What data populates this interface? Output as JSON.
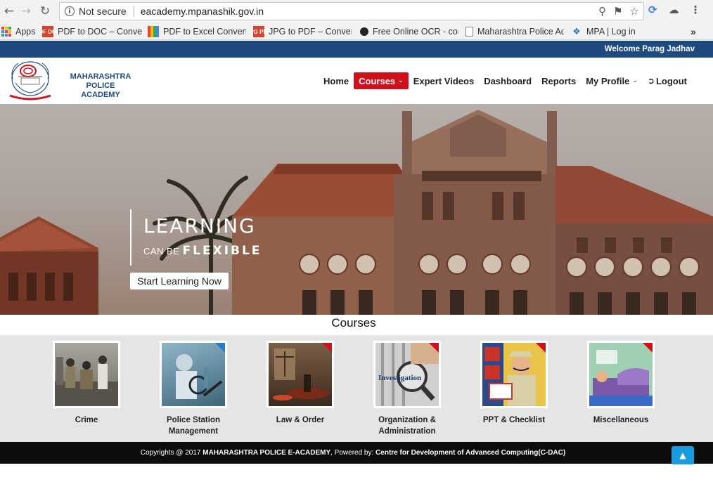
{
  "browser": {
    "security_label": "Not secure",
    "url": "eacademy.mpanashik.gov.in",
    "bookmarks": [
      {
        "label": "Apps"
      },
      {
        "label": "PDF to DOC – Convert"
      },
      {
        "label": "PDF to Excel Converte"
      },
      {
        "label": "JPG to PDF – Convert"
      },
      {
        "label": "Free Online OCR - cor"
      },
      {
        "label": "Maharashtra Police Ac"
      },
      {
        "label": "MPA | Log in"
      }
    ],
    "bookmark_badges": {
      "pdf_doc": "PDF DOC",
      "jpg_pdf": "JPG PDF"
    },
    "more_bookmarks": "»"
  },
  "site": {
    "welcome": "Welcome Parag Jadhav",
    "brand_line1": "MAHARASHTRA POLICE",
    "brand_line2": "ACADEMY",
    "nav": [
      {
        "label": "Home"
      },
      {
        "label": "Courses",
        "active": true
      },
      {
        "label": "Expert Videos"
      },
      {
        "label": "Dashboard"
      },
      {
        "label": "Reports"
      },
      {
        "label": "My Profile"
      },
      {
        "label": "Logout"
      }
    ],
    "accent_color": "#d0111b",
    "brand_color": "#1e4a80"
  },
  "hero": {
    "title": "LEARNING",
    "sub_prefix": "CAN BE",
    "sub_emph": "FLEXIBLE",
    "button": "Start Learning Now"
  },
  "courses": {
    "heading": "Courses",
    "items": [
      {
        "label": "Crime"
      },
      {
        "label": "Police Station Management"
      },
      {
        "label": "Law & Order"
      },
      {
        "label": "Organization & Administration",
        "image_text": "Investigation"
      },
      {
        "label": "PPT & Checklist"
      },
      {
        "label": "Miscellaneous"
      }
    ]
  },
  "footer": {
    "prefix": "Copyrights @ 2017 ",
    "org": "MAHARASHTRA POLICE E-ACADEMY",
    "powered": ", Powered by: ",
    "cdac": "Centre for Development of Advanced Computing(C-DAC)"
  },
  "icons": {
    "back": "back-icon",
    "forward": "forward-icon",
    "reload": "reload-icon",
    "scroll_top": "chevron-up-icon"
  }
}
